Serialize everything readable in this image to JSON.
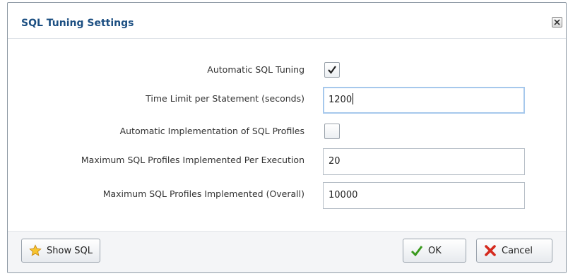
{
  "dialog": {
    "title": "SQL Tuning Settings",
    "close_icon": "close-icon"
  },
  "form": {
    "auto_tuning": {
      "label": "Automatic SQL Tuning",
      "checked": true
    },
    "time_limit": {
      "label": "Time Limit per Statement (seconds)",
      "value": "1200"
    },
    "auto_impl": {
      "label": "Automatic Implementation of SQL Profiles",
      "checked": false
    },
    "max_per_exec": {
      "label": "Maximum SQL Profiles Implemented Per Execution",
      "value": "20"
    },
    "max_overall": {
      "label": "Maximum SQL Profiles Implemented (Overall)",
      "value": "10000"
    }
  },
  "footer": {
    "show_sql_label": "Show SQL",
    "show_sql_icon": "star-icon",
    "ok_label": "OK",
    "ok_icon": "green-checkmark-icon",
    "cancel_label": "Cancel",
    "cancel_icon": "red-x-icon"
  },
  "colors": {
    "title": "#1c4f82",
    "focus_border": "#a6c8ec"
  }
}
